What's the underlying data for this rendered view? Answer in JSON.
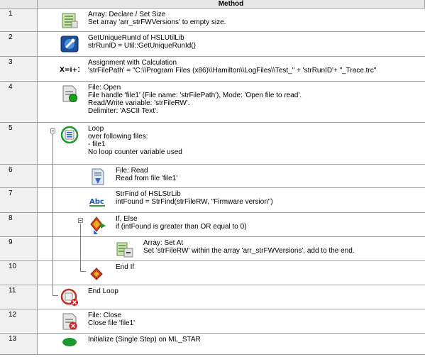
{
  "header": {
    "method_label": "Method"
  },
  "rows": [
    {
      "num": "1",
      "icon": "array-declare-icon",
      "lines": [
        "Array: Declare / Set Size",
        "Set array 'arr_strFWVersions' to empty size."
      ]
    },
    {
      "num": "2",
      "icon": "hsl-util-lib-icon",
      "lines": [
        "GetUniqueRunId of HSLUtilLib",
        "strRunID = Util::GetUniqueRunId()"
      ]
    },
    {
      "num": "3",
      "icon": "assignment-calc-icon",
      "icon_text": "X=i+1",
      "lines": [
        "Assignment with Calculation",
        "'strFilePath' = \"C:\\\\Program Files (x86)\\\\Hamilton\\\\LogFiles\\\\Test_\" + 'strRunID'+ \"_Trace.trc\""
      ]
    },
    {
      "num": "4",
      "icon": "file-open-icon",
      "lines": [
        "File: Open",
        "File handle 'file1' (File name: 'strFilePath'),  Mode: 'Open file to read'.",
        "Read/Write variable: 'strFileRW'.",
        "Delimiter: 'ASCII Text'."
      ]
    },
    {
      "num": "5",
      "icon": "loop-icon",
      "lines": [
        "Loop",
        "over following files:",
        "- file1",
        "No loop counter variable used"
      ]
    },
    {
      "num": "6",
      "icon": "file-read-icon",
      "lines": [
        "File: Read",
        "Read from file 'file1'"
      ]
    },
    {
      "num": "7",
      "icon": "strfind-icon",
      "icon_text": "Abc",
      "lines": [
        "StrFind of HSLStrLib",
        "intFound = StrFind(strFileRW, \"Firmware version\")"
      ]
    },
    {
      "num": "8",
      "icon": "if-else-icon",
      "lines": [
        "If, Else",
        "if (intFound is greater than OR equal to 0)"
      ]
    },
    {
      "num": "9",
      "icon": "array-set-at-icon",
      "lines": [
        "Array: Set At",
        "Set 'strFileRW' within the array 'arr_strFWVersions', add to the end."
      ]
    },
    {
      "num": "10",
      "icon": "end-if-icon",
      "lines": [
        "End If"
      ]
    },
    {
      "num": "11",
      "icon": "end-loop-icon",
      "lines": [
        "End Loop"
      ]
    },
    {
      "num": "12",
      "icon": "file-close-icon",
      "lines": [
        "File: Close",
        "Close file 'file1'"
      ]
    },
    {
      "num": "13",
      "icon": "initialize-icon",
      "lines": [
        "Initialize (Single Step) on ML_STAR"
      ]
    }
  ]
}
